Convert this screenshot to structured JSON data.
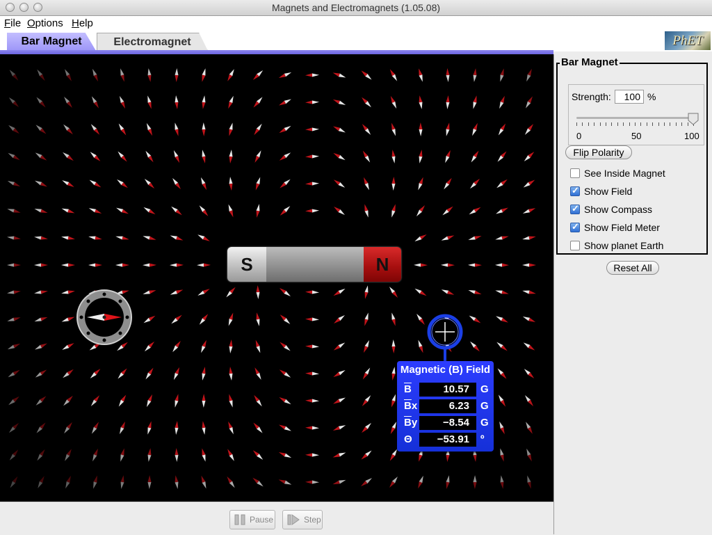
{
  "window": {
    "title": "Magnets and Electromagnets (1.05.08)"
  },
  "menu": {
    "items": [
      {
        "label": "File",
        "mnemonic": "F",
        "rest": "ile"
      },
      {
        "label": "Options",
        "mnemonic": "O",
        "rest": "ptions"
      },
      {
        "label": "Help",
        "mnemonic": "H",
        "rest": "elp"
      }
    ]
  },
  "tabs": [
    {
      "label": "Bar Magnet",
      "selected": true
    },
    {
      "label": "Electromagnet",
      "selected": false
    }
  ],
  "logo": {
    "text": "PhET"
  },
  "magnet": {
    "south_label": "S",
    "north_label": "N"
  },
  "field_meter": {
    "title": "Magnetic (B) Field",
    "rows": [
      {
        "label": "B",
        "suffix": "",
        "value": "10.57",
        "unit": "G"
      },
      {
        "label": "B",
        "suffix": "x",
        "value": "6.23",
        "unit": "G"
      },
      {
        "label": "B",
        "suffix": "y",
        "value": "−8.54",
        "unit": "G"
      },
      {
        "label": "Θ",
        "suffix": "",
        "value": "−53.91",
        "unit": "º"
      }
    ]
  },
  "clock": {
    "pause_label": "Pause",
    "step_label": "Step"
  },
  "panel": {
    "title": "Bar Magnet",
    "strength_label": "Strength:",
    "strength_value": "100",
    "strength_unit": "%",
    "slider": {
      "min_label": "0",
      "mid_label": "50",
      "max_label": "100",
      "value_fraction": 1.0
    },
    "flip_polarity_label": "Flip Polarity",
    "checkboxes": [
      {
        "label": "See Inside Magnet",
        "checked": false
      },
      {
        "label": "Show Field",
        "checked": true
      },
      {
        "label": "Show Compass",
        "checked": true
      },
      {
        "label": "Show Field Meter",
        "checked": true
      },
      {
        "label": "Show planet Earth",
        "checked": false
      }
    ],
    "reset_all_label": "Reset All"
  },
  "colors": {
    "tab_selected": "#9d96f8",
    "needle_north": "#c0141a",
    "needle_south": "#e6e6e6",
    "meter_bg": "#1f36e8"
  }
}
